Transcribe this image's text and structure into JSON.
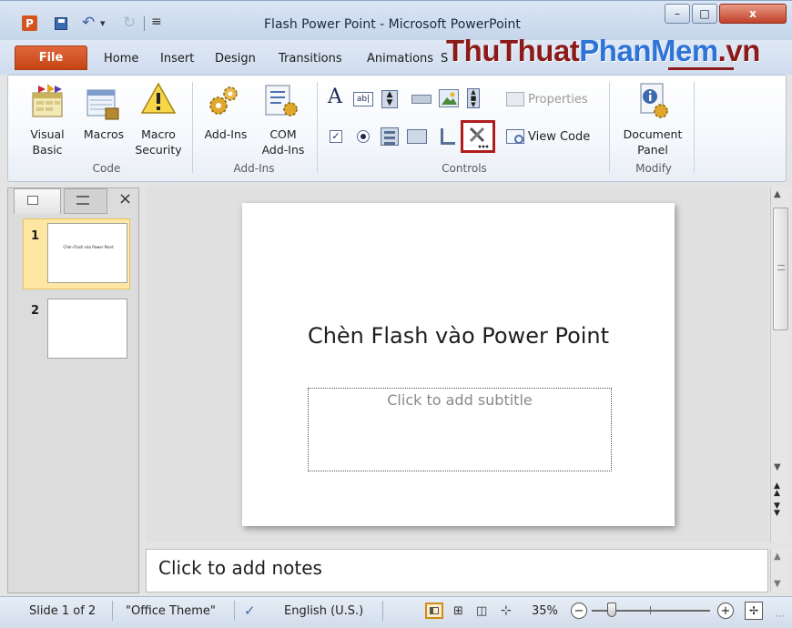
{
  "window": {
    "title": "Flash Power Point  -  Microsoft PowerPoint",
    "watermark": "ThuThuatPhanMem.vn",
    "controls": {
      "minimize": "–",
      "maximize": "□",
      "close": "x"
    }
  },
  "quick_access": {
    "app_letter": "P",
    "dropdown_glyph": "▾",
    "customize_glyph": "≡"
  },
  "tabs": [
    "File",
    "Home",
    "Insert",
    "Design",
    "Transitions",
    "Animations",
    "S"
  ],
  "ribbon": {
    "code_group": {
      "label": "Code",
      "visual_basic": [
        "Visual",
        "Basic"
      ],
      "macros": "Macros",
      "macro_security": [
        "Macro",
        "Security"
      ]
    },
    "addins_group": {
      "label": "Add-Ins",
      "addins": "Add-Ins",
      "com_addins": [
        "COM",
        "Add-Ins"
      ]
    },
    "controls_group": {
      "label": "Controls",
      "label_glyph": "A",
      "properties": "Properties",
      "view_code": "View Code"
    },
    "modify_group": {
      "label": "Modify",
      "document_panel": [
        "Document",
        "Panel"
      ]
    }
  },
  "slides_panel": {
    "close_glyph": "×",
    "slides": [
      {
        "number": "1",
        "thumb_text": "Chèn Flash vào Power Point"
      },
      {
        "number": "2",
        "thumb_text": ""
      }
    ]
  },
  "slide": {
    "title": "Chèn Flash vào Power Point",
    "subtitle_placeholder": "Click to add subtitle"
  },
  "notes": {
    "placeholder": "Click to add notes"
  },
  "status": {
    "slide_position": "Slide 1 of 2",
    "theme": "\"Office Theme\"",
    "language": "English (U.S.)",
    "zoom": "35%",
    "zoom_out": "−",
    "zoom_in": "+",
    "zoom_level": 0.35
  },
  "colors": {
    "file_tab": "#d4521f",
    "highlight_border": "#b01c1c",
    "watermark_dark": "#8b1a1a",
    "watermark_blue": "#2e74d6"
  }
}
